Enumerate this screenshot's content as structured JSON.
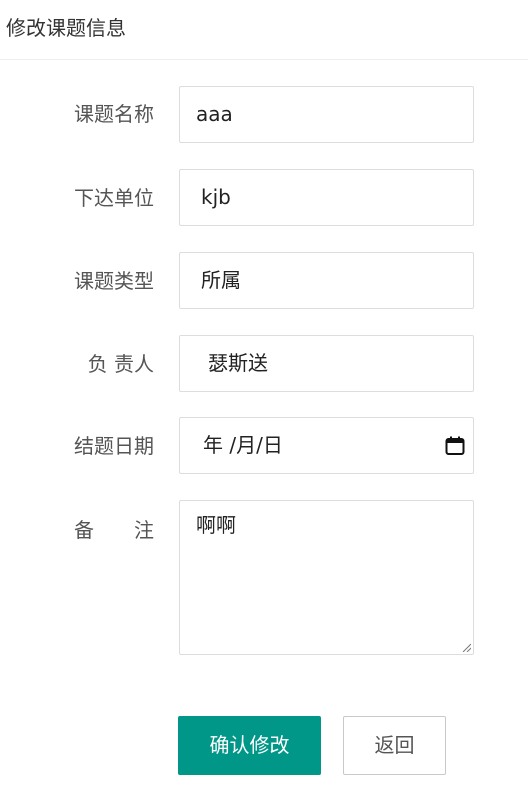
{
  "header": {
    "title": "修改课题信息"
  },
  "form": {
    "name": {
      "label": "课题名称",
      "value": "aaa"
    },
    "issuer": {
      "label": "下达单位",
      "value": "kjb"
    },
    "type": {
      "label": "课题类型",
      "value": "所属"
    },
    "leader": {
      "label": "负 责人",
      "value": "瑟斯送"
    },
    "end_date": {
      "label": "结题日期",
      "value": "年 /月/日",
      "icon": "calendar-icon"
    },
    "remark": {
      "label": "备　　注",
      "value": "啊啊"
    }
  },
  "actions": {
    "confirm_label": "确认修改",
    "back_label": "返回"
  },
  "colors": {
    "primary": "#009688",
    "border": "#dddddd",
    "label": "#555555"
  }
}
